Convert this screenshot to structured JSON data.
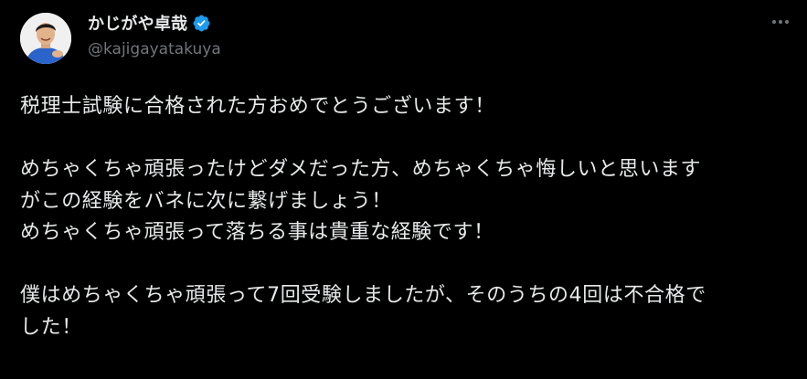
{
  "author": {
    "display_name": "かじがや卓哉",
    "handle": "@kajigayatakuya",
    "verified": true
  },
  "menu": {
    "icon": "more-horizontal-icon"
  },
  "tweet": {
    "lines": [
      "税理士試験に合格された方おめでとうございます！",
      "",
      "めちゃくちゃ頑張ったけどダメだった方、めちゃくちゃ悔しいと思います",
      "がこの経験をバネに次に繋げましょう！",
      "めちゃくちゃ頑張って落ちる事は貴重な経験です！",
      "",
      "僕はめちゃくちゃ頑張って7回受験しましたが、そのうちの4回は不合格で",
      "した！"
    ]
  },
  "colors": {
    "background": "#000000",
    "text": "#e7e9ea",
    "secondary": "#71767b",
    "verified_badge": "#1d9bf0"
  }
}
